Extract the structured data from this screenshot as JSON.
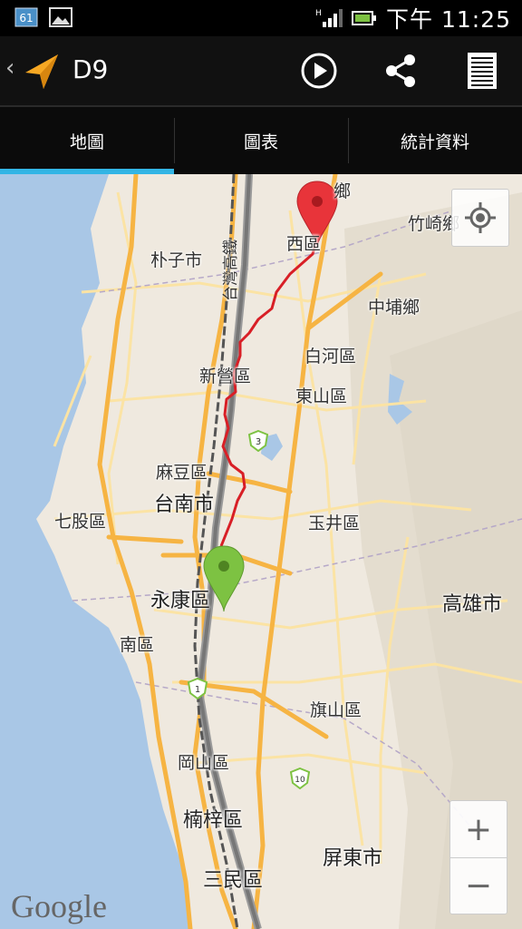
{
  "status_bar": {
    "calendar_badge": "61",
    "time": "下午 11:25"
  },
  "action_bar": {
    "title": "D9"
  },
  "tabs": [
    {
      "label": "地圖",
      "selected": true
    },
    {
      "label": "圖表",
      "selected": false
    },
    {
      "label": "統計資料",
      "selected": false
    }
  ],
  "map": {
    "places": {
      "xigu": "西區",
      "zhuqi": "竹崎鄉",
      "puzi": "朴子市",
      "zhongpu": "中埔鄉",
      "baihe": "白河區",
      "xinying": "新營區",
      "dongshan": "東山區",
      "madou": "麻豆區",
      "tainan": "台南市",
      "qigu": "七股區",
      "yujing": "玉井區",
      "yongkang": "永康區",
      "kaohsiung": "高雄市",
      "nanqu": "南區",
      "qishan": "旗山區",
      "gangshan": "岡山區",
      "nanzi": "楠梓區",
      "pingtung": "屏東市",
      "sanmin": "三民區",
      "xiang_top": "鄉"
    },
    "rail_label": "台灣高鐵",
    "route_shields": [
      "3",
      "1",
      "10"
    ],
    "zoom_in_label": "+",
    "zoom_out_label": "−",
    "attribution": "Google",
    "colors": {
      "track": "#d81f26",
      "start_marker": "#7dc242",
      "end_marker": "#e8343a",
      "highway": "#f6b443",
      "sea": "#a9c7e6"
    }
  }
}
